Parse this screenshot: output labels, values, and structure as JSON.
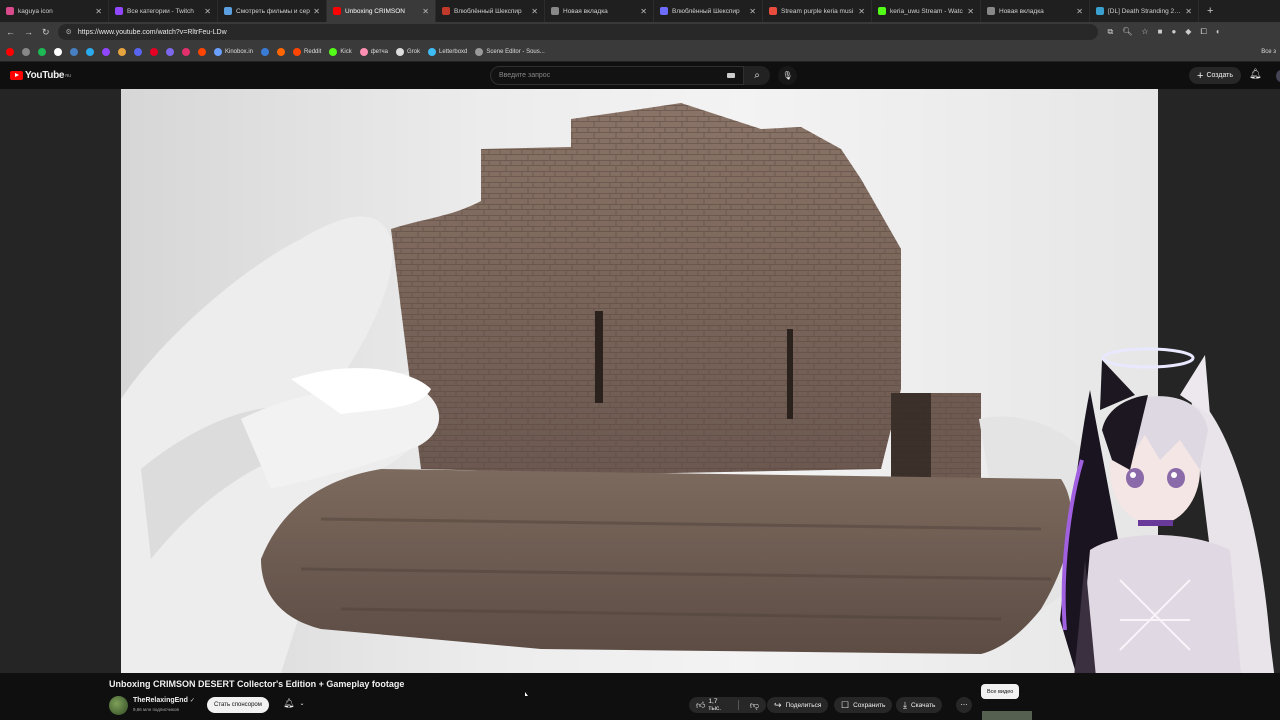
{
  "browser": {
    "tabs": [
      {
        "title": "kaguya icon",
        "color": "#d94a8c"
      },
      {
        "title": "Все категории - Twitch",
        "color": "#9146ff"
      },
      {
        "title": "Смотреть фильмы и сер",
        "color": "#5aa0e0"
      },
      {
        "title": "Unboxing CRIMSON",
        "color": "#ff0000",
        "active": true
      },
      {
        "title": "Влюблённый Шекспир",
        "color": "#c0392b"
      },
      {
        "title": "Новая вкладка",
        "color": "#888888"
      },
      {
        "title": "Влюблённый Шекспир",
        "color": "#6c6cff"
      },
      {
        "title": "Stream purple keria musi",
        "color": "#e74c3c"
      },
      {
        "title": "keria_uwu Stream - Watc",
        "color": "#53fc18"
      },
      {
        "title": "Новая вкладка",
        "color": "#888888"
      },
      {
        "title": "[DL] Death Stranding 2: C",
        "color": "#3aa0d0"
      }
    ],
    "url": "https://www.youtube.com/watch?v=RltrFeu-LDw",
    "bookmarks": [
      {
        "label": "",
        "color": "#ff0000"
      },
      {
        "label": "",
        "color": "#888"
      },
      {
        "label": "",
        "color": "#1db954"
      },
      {
        "label": "",
        "color": "#ffffff"
      },
      {
        "label": "",
        "color": "#4680c2"
      },
      {
        "label": "",
        "color": "#2aabee"
      },
      {
        "label": "",
        "color": "#9146ff"
      },
      {
        "label": "",
        "color": "#e7a33e"
      },
      {
        "label": "",
        "color": "#5865f2"
      },
      {
        "label": "",
        "color": "#e60023"
      },
      {
        "label": "",
        "color": "#7b68ee"
      },
      {
        "label": "",
        "color": "#e1306c"
      },
      {
        "label": "",
        "color": "#ff4500"
      },
      {
        "label": "Kinobox.in",
        "color": "#6aa0ff"
      },
      {
        "label": "",
        "color": "#3a7bd5"
      },
      {
        "label": "",
        "color": "#ff6600"
      },
      {
        "label": "Reddit",
        "color": "#ff4500"
      },
      {
        "label": "Kick",
        "color": "#53fc18"
      },
      {
        "label": "фетча",
        "color": "#ff8fb1"
      },
      {
        "label": "Grok",
        "color": "#dddddd"
      },
      {
        "label": "Letterboxd",
        "color": "#40bcf4"
      },
      {
        "label": "Scene Editor - Sous...",
        "color": "#999999"
      }
    ],
    "bookmarks_right": "Все з"
  },
  "youtube": {
    "logo": "YouTube",
    "region": "RU",
    "search_placeholder": "Введите запрос",
    "create_label": "Создать"
  },
  "video": {
    "title": "Unboxing CRIMSON DESERT Collector's Edition + Gameplay footage",
    "channel": "TheRelaxingEnd",
    "subscribers": "9,66 млн подписчиков",
    "sponsor_label": "Стать спонсором",
    "likes": "1,7 тыс.",
    "share_label": "Поделиться",
    "save_label": "Сохранить",
    "download_label": "Скачать",
    "all_videos_label": "Все видео"
  }
}
